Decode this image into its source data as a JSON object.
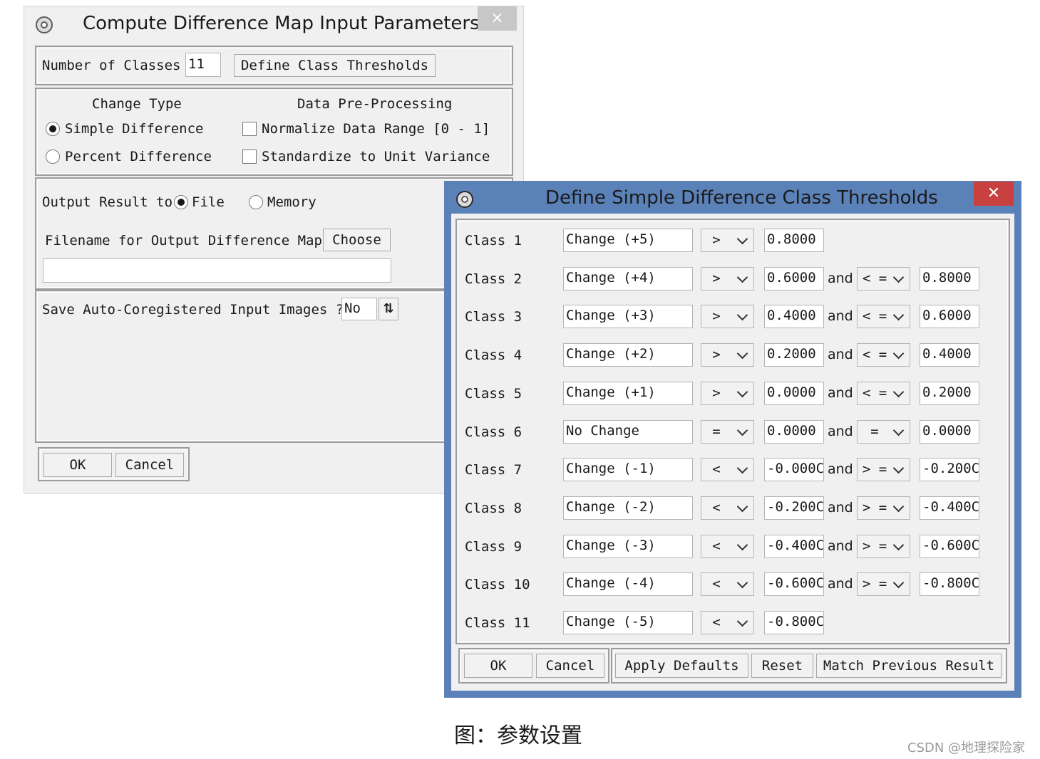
{
  "main_dialog": {
    "title": "Compute Difference Map Input Parameters",
    "close_glyph": "×",
    "num_classes_label": "Number of Classes",
    "num_classes_value": "11",
    "define_thresholds_button": "Define Class Thresholds",
    "change_type_header": "Change Type",
    "preprocessing_header": "Data Pre-Processing",
    "simple_difference_label": "Simple Difference",
    "percent_difference_label": "Percent Difference",
    "change_type_selected": "Simple Difference",
    "normalize_label": "Normalize Data Range [0 - 1]",
    "normalize_checked": false,
    "standardize_label": "Standardize to Unit Variance",
    "standardize_checked": false,
    "output_result_label": "Output Result to",
    "file_label": "File",
    "memory_label": "Memory",
    "output_selected": "File",
    "filename_label": "Filename for Output Difference Map",
    "choose_button": "Choose",
    "filename_value": "",
    "save_coreg_label": "Save Auto-Coregistered Input Images ?",
    "save_coreg_value": "No",
    "toggle_glyph": "⇅",
    "ok_button": "OK",
    "cancel_button": "Cancel"
  },
  "threshold_dialog": {
    "title": "Define Simple Difference Class Thresholds",
    "close_glyph": "✕",
    "and_label": "and",
    "rows": [
      {
        "label": "Class 1",
        "name": "Change (+5)",
        "op1": ">",
        "val1": "0.8000",
        "op2": "",
        "val2": ""
      },
      {
        "label": "Class 2",
        "name": "Change (+4)",
        "op1": ">",
        "val1": "0.6000",
        "op2": "< =",
        "val2": "0.8000"
      },
      {
        "label": "Class 3",
        "name": "Change (+3)",
        "op1": ">",
        "val1": "0.4000",
        "op2": "< =",
        "val2": "0.6000"
      },
      {
        "label": "Class 4",
        "name": "Change (+2)",
        "op1": ">",
        "val1": "0.2000",
        "op2": "< =",
        "val2": "0.4000"
      },
      {
        "label": "Class 5",
        "name": "Change (+1)",
        "op1": ">",
        "val1": "0.0000",
        "op2": "< =",
        "val2": "0.2000"
      },
      {
        "label": "Class 6",
        "name": "No Change",
        "op1": "=",
        "val1": "0.0000",
        "op2": "=",
        "val2": "0.0000"
      },
      {
        "label": "Class 7",
        "name": "Change (-1)",
        "op1": "<",
        "val1": "-0.000C",
        "op2": "> =",
        "val2": "-0.200C"
      },
      {
        "label": "Class 8",
        "name": "Change (-2)",
        "op1": "<",
        "val1": "-0.200C",
        "op2": "> =",
        "val2": "-0.400C"
      },
      {
        "label": "Class 9",
        "name": "Change (-3)",
        "op1": "<",
        "val1": "-0.400C",
        "op2": "> =",
        "val2": "-0.600C"
      },
      {
        "label": "Class 10",
        "name": "Change (-4)",
        "op1": "<",
        "val1": "-0.600C",
        "op2": "> =",
        "val2": "-0.800C"
      },
      {
        "label": "Class 11",
        "name": "Change (-5)",
        "op1": "<",
        "val1": "-0.800C",
        "op2": "",
        "val2": ""
      }
    ],
    "ok_button": "OK",
    "cancel_button": "Cancel",
    "apply_defaults_button": "Apply Defaults",
    "reset_button": "Reset",
    "match_previous_button": "Match Previous Result"
  },
  "caption": "图：参数设置",
  "watermark": "CSDN @地理探险家",
  "colors": {
    "dialog_bg": "#f0f0f0",
    "active_titlebar": "#5b82b8",
    "close_active": "#c84040",
    "close_inactive": "#c7c7c7"
  }
}
